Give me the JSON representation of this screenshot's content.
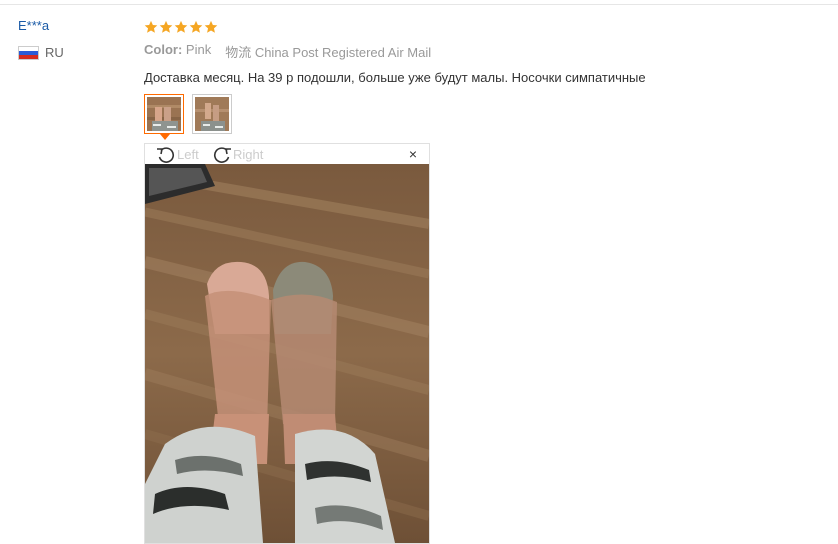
{
  "buyer": {
    "name": "E***a",
    "country": "RU"
  },
  "review": {
    "rating": 5,
    "color_label": "Color:",
    "color_value": "Pink",
    "shipping": "物流 China Post Registered Air Mail",
    "text": "Доставка месяц. На 39 р подошли, больше уже будут малы. Носочки симпатичные"
  },
  "viewer": {
    "rotate_left": "Left",
    "rotate_right": "Right",
    "close": "×"
  },
  "colors": {
    "accent": "#ff6a00",
    "star": "#f5a623",
    "link": "#1a5aa6"
  }
}
